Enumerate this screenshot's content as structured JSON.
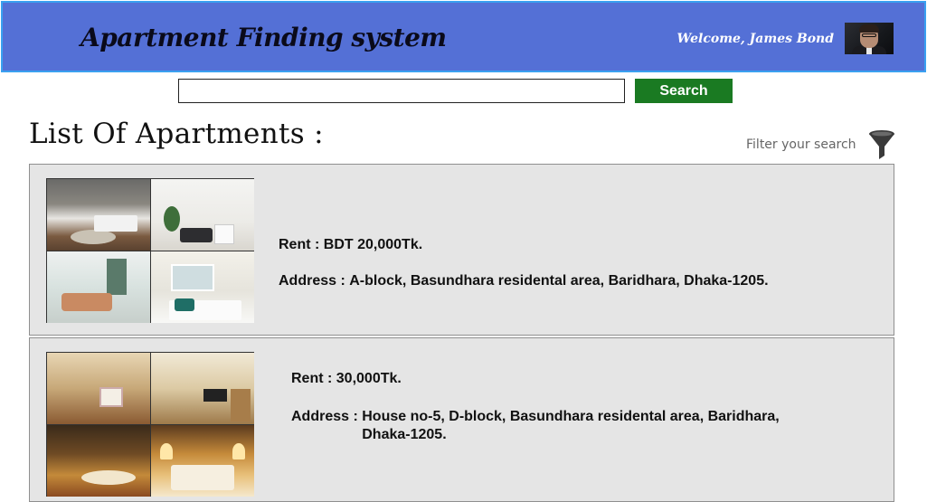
{
  "header": {
    "title": "Apartment Finding system",
    "welcome": "Welcome, James Bond",
    "bg_color": "#5470d6"
  },
  "search": {
    "value": "",
    "placeholder": "",
    "button_label": "Search",
    "button_color": "#1a7a22"
  },
  "list": {
    "title": "List Of Apartments :",
    "filter_label": "Filter your search",
    "filter_icon": "funnel-icon"
  },
  "apartments": [
    {
      "rent_label": "Rent :",
      "rent_value": "BDT 20,000Tk.",
      "address_label": "Address :",
      "address_value": "A-block, Basundhara residental area, Baridhara, Dhaka-1205."
    },
    {
      "rent_label": "Rent :",
      "rent_value": "30,000Tk.",
      "address_label": "Address :",
      "address_value": "House no-5, D-block, Basundhara residental area, Baridhara, Dhaka-1205."
    }
  ]
}
